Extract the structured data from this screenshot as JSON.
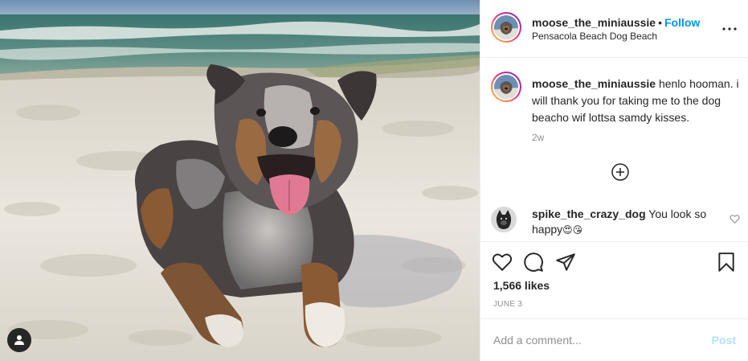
{
  "post": {
    "author": {
      "username": "moose_the_miniaussie",
      "location": "Pensacola Beach Dog Beach",
      "follow_label": "Follow",
      "separator": "•"
    },
    "caption": {
      "username": "moose_the_miniaussie",
      "text": " henlo hooman. i will thank you for taking me to the dog beacho wif lottsa samdy kisses.",
      "time_ago": "2w"
    },
    "comments": [
      {
        "username": "spike_the_crazy_dog",
        "text": " You look so happy",
        "emojis": "😍😘"
      }
    ],
    "likes_text": "1,566 likes",
    "date": "JUNE 3",
    "add_comment": {
      "placeholder": "Add a comment...",
      "post_label": "Post"
    },
    "icons": {
      "more": "more-options-icon",
      "load_more": "plus-circle-icon",
      "like_small": "heart-outline-icon",
      "like": "heart-outline-icon",
      "comment": "comment-bubble-icon",
      "share": "paper-plane-icon",
      "save": "bookmark-icon",
      "tag_user": "user-tag-icon"
    },
    "colors": {
      "accent": "#0095f6",
      "post_disabled": "#b2dffc",
      "text": "#262626",
      "muted": "#8e8e8e",
      "border": "#efefef"
    }
  }
}
